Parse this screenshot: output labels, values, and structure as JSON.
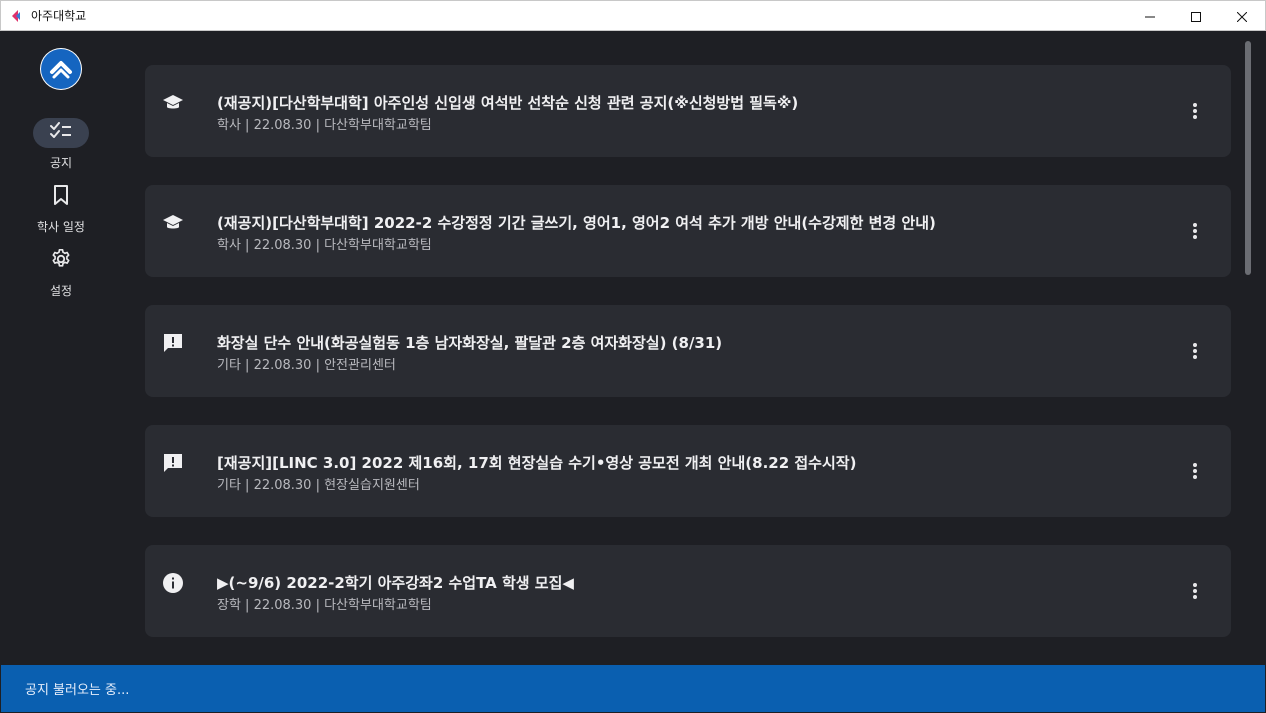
{
  "window": {
    "title": "아주대학교",
    "controls": [
      "minimize-icon",
      "maximize-icon",
      "close-icon"
    ]
  },
  "sidebar": {
    "logo": "ajou-logo",
    "items": [
      {
        "label": "공지",
        "icon": "checklist-icon",
        "active": true
      },
      {
        "label": "학사 일정",
        "icon": "bookmark-icon",
        "active": false
      },
      {
        "label": "설정",
        "icon": "gear-icon",
        "active": false
      }
    ]
  },
  "notices": [
    {
      "icon": "graduation-cap-icon",
      "title": "(재공지)[다산학부대학] 아주인성 신입생 여석반 선착순 신청 관련 공지(※신청방법 필독※)",
      "meta": "학사 | 22.08.30 | 다산학부대학교학팀"
    },
    {
      "icon": "graduation-cap-icon",
      "title": "(재공지)[다산학부대학] 2022-2 수강정정 기간 글쓰기, 영어1, 영어2 여석 추가 개방 안내(수강제한 변경 안내)",
      "meta": "학사 | 22.08.30 | 다산학부대학교학팀"
    },
    {
      "icon": "announcement-icon",
      "title": "화장실 단수 안내(화공실험동 1층 남자화장실, 팔달관 2층 여자화장실) (8/31)",
      "meta": "기타 | 22.08.30 | 안전관리센터"
    },
    {
      "icon": "announcement-icon",
      "title": "[재공지][LINC 3.0] 2022 제16회, 17회 현장실습 수기•영상 공모전 개최 안내(8.22 접수시작)",
      "meta": "기타 | 22.08.30 | 현장실습지원센터"
    },
    {
      "icon": "info-icon",
      "title": "▶(~9/6) 2022-2학기 아주강좌2 수업TA 학생 모집◀",
      "meta": "장학 | 22.08.30 | 다산학부대학교학팀"
    }
  ],
  "status": {
    "text": "공지 불러오는 중..."
  },
  "colors": {
    "background": "#1e1f24",
    "card": "#2a2c32",
    "status_bar": "#0a5fb0",
    "nav_active": "#3a4150",
    "logo_blue": "#1565c0"
  }
}
